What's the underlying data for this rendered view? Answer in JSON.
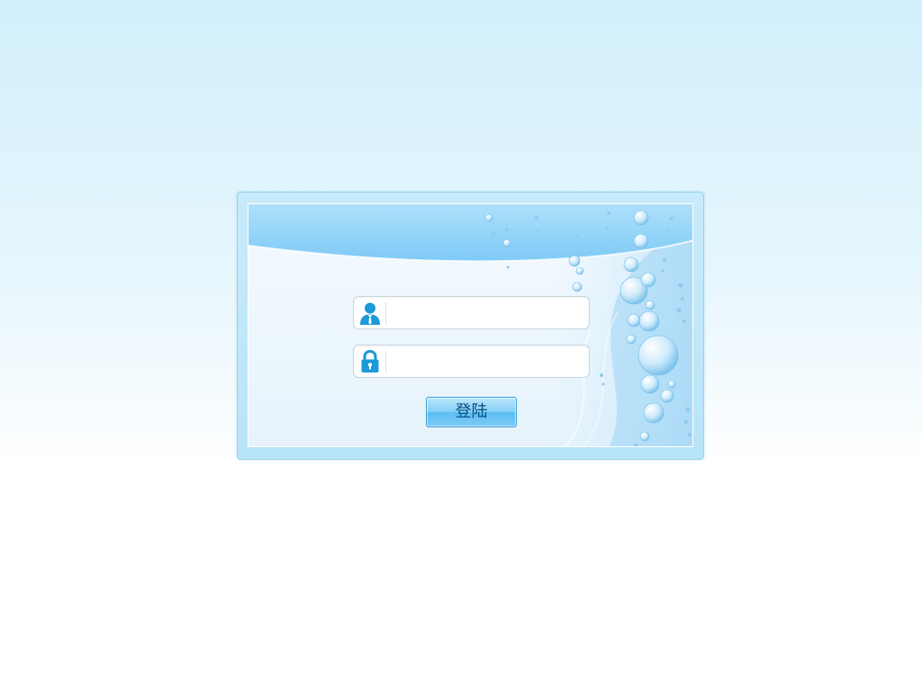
{
  "login": {
    "username": {
      "value": "",
      "placeholder": "",
      "icon": "user-icon"
    },
    "password": {
      "value": "",
      "placeholder": "",
      "icon": "lock-icon"
    },
    "submit_label": "登陆"
  },
  "colors": {
    "page_top": "#d2f0fc",
    "page_bottom": "#ffffff",
    "panel_border": "#98d2ec",
    "icon_blue": "#1a9ad8",
    "button_border": "#3a9fd6",
    "button_text": "#0a4f86"
  }
}
